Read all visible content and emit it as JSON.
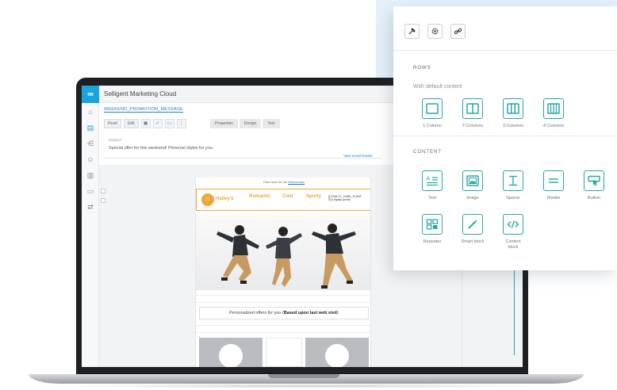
{
  "app": {
    "title": "Selligent Marketing Cloud",
    "message_name": "WEEKEND_PROMOTION_MESSAGE",
    "toolbar": {
      "read_label": "Read",
      "edit_label": "Edit"
    },
    "tabs": [
      "Properties",
      "Design",
      "Test"
    ],
    "subject": {
      "label": "Subject*",
      "value": "Special offer for this weekend! Personal styles for you.",
      "view_header_link": "View email header"
    }
  },
  "email": {
    "top_text": "Click here for the",
    "top_link": "Webversion",
    "brand": "Hailey's",
    "brand_initials": "H",
    "nav": [
      "Romantic",
      "Cool",
      "Sporty"
    ],
    "loyalty_line1": "[LOYALTY_CARD_POINT",
    "loyalty_line2": "S]*] loyalty points",
    "personal_text": "Personalized offers for you (",
    "personal_bold": "Based upon last web visit",
    "personal_end": ")"
  },
  "panel": {
    "rows_title": "ROWS",
    "rows_subtitle": "With default content",
    "rows": [
      {
        "label": "1 Column",
        "icon": "one-column-icon"
      },
      {
        "label": "2 Columns",
        "icon": "two-columns-icon"
      },
      {
        "label": "3 Columns",
        "icon": "three-columns-icon"
      },
      {
        "label": "4 Columns",
        "icon": "four-columns-icon"
      }
    ],
    "content_title": "CONTENT",
    "content": [
      {
        "label": "Text",
        "icon": "text-icon"
      },
      {
        "label": "Image",
        "icon": "image-icon"
      },
      {
        "label": "Spacer",
        "icon": "spacer-icon"
      },
      {
        "label": "Divider",
        "icon": "divider-icon"
      },
      {
        "label": "Button",
        "icon": "button-icon"
      },
      {
        "label": "Repeater",
        "icon": "repeater-icon"
      },
      {
        "label": "Smart block",
        "icon": "smart-block-icon"
      },
      {
        "label": "Content\nblock",
        "icon": "content-block-icon"
      }
    ],
    "accent_color": "#25a6a8"
  }
}
